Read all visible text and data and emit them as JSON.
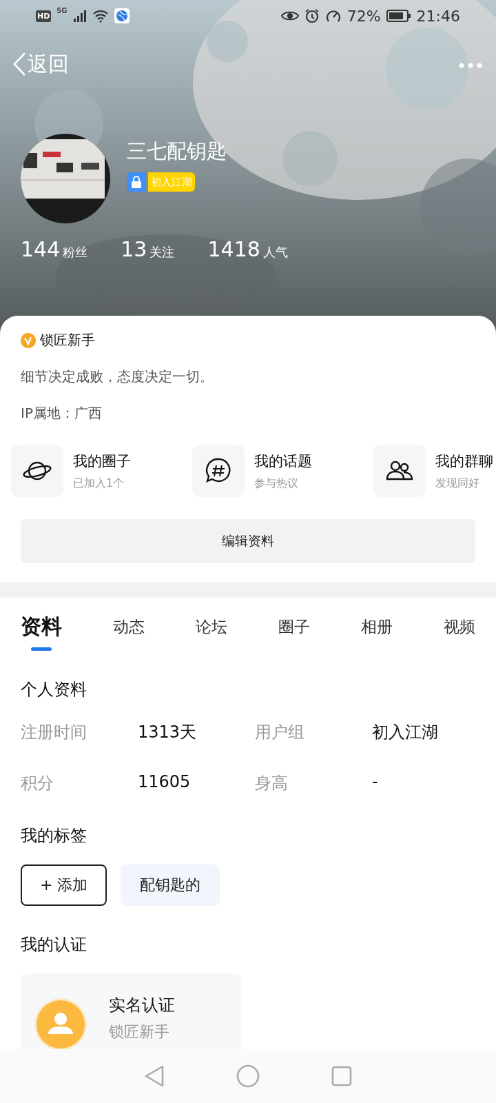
{
  "status_bar": {
    "network_badge": "HD",
    "network_type": "5G",
    "battery_percent": "72%",
    "time": "21:46"
  },
  "header": {
    "back_label": "返回"
  },
  "profile": {
    "name": "三七配钥匙",
    "level_badge": "初入江湖",
    "stats": [
      {
        "value": "144",
        "label": "粉丝"
      },
      {
        "value": "13",
        "label": "关注"
      },
      {
        "value": "1418",
        "label": "人气"
      }
    ]
  },
  "info": {
    "title": "锁匠新手",
    "motto": "细节决定成败，态度决定一切。",
    "ip_location": "IP属地：广西"
  },
  "shortcuts": [
    {
      "kind": "planet",
      "title": "我的圈子",
      "subtitle": "已加入1个"
    },
    {
      "kind": "topic",
      "title": "我的话题",
      "subtitle": "参与热议"
    },
    {
      "kind": "group",
      "title": "我的群聊",
      "subtitle": "发现同好"
    }
  ],
  "edit_button": "编辑资料",
  "tabs": [
    {
      "label": "资料",
      "selected": true
    },
    {
      "label": "动态",
      "selected": false
    },
    {
      "label": "论坛",
      "selected": false
    },
    {
      "label": "圈子",
      "selected": false
    },
    {
      "label": "相册",
      "selected": false
    },
    {
      "label": "视频",
      "selected": false
    }
  ],
  "personal_info": {
    "title": "个人资料",
    "fields": [
      {
        "label": "注册时间",
        "value": "1313天"
      },
      {
        "label": "用户组",
        "value": "初入江湖"
      },
      {
        "label": "积分",
        "value": "11605"
      },
      {
        "label": "身高",
        "value": "-"
      }
    ]
  },
  "tags": {
    "title": "我的标签",
    "items": [
      {
        "kind": "add",
        "label": "+ 添加"
      },
      {
        "kind": "tag",
        "label": "配钥匙的"
      }
    ]
  },
  "certification": {
    "title": "我的认证",
    "card": {
      "title": "实名认证",
      "subtitle": "锁匠新手"
    }
  }
}
